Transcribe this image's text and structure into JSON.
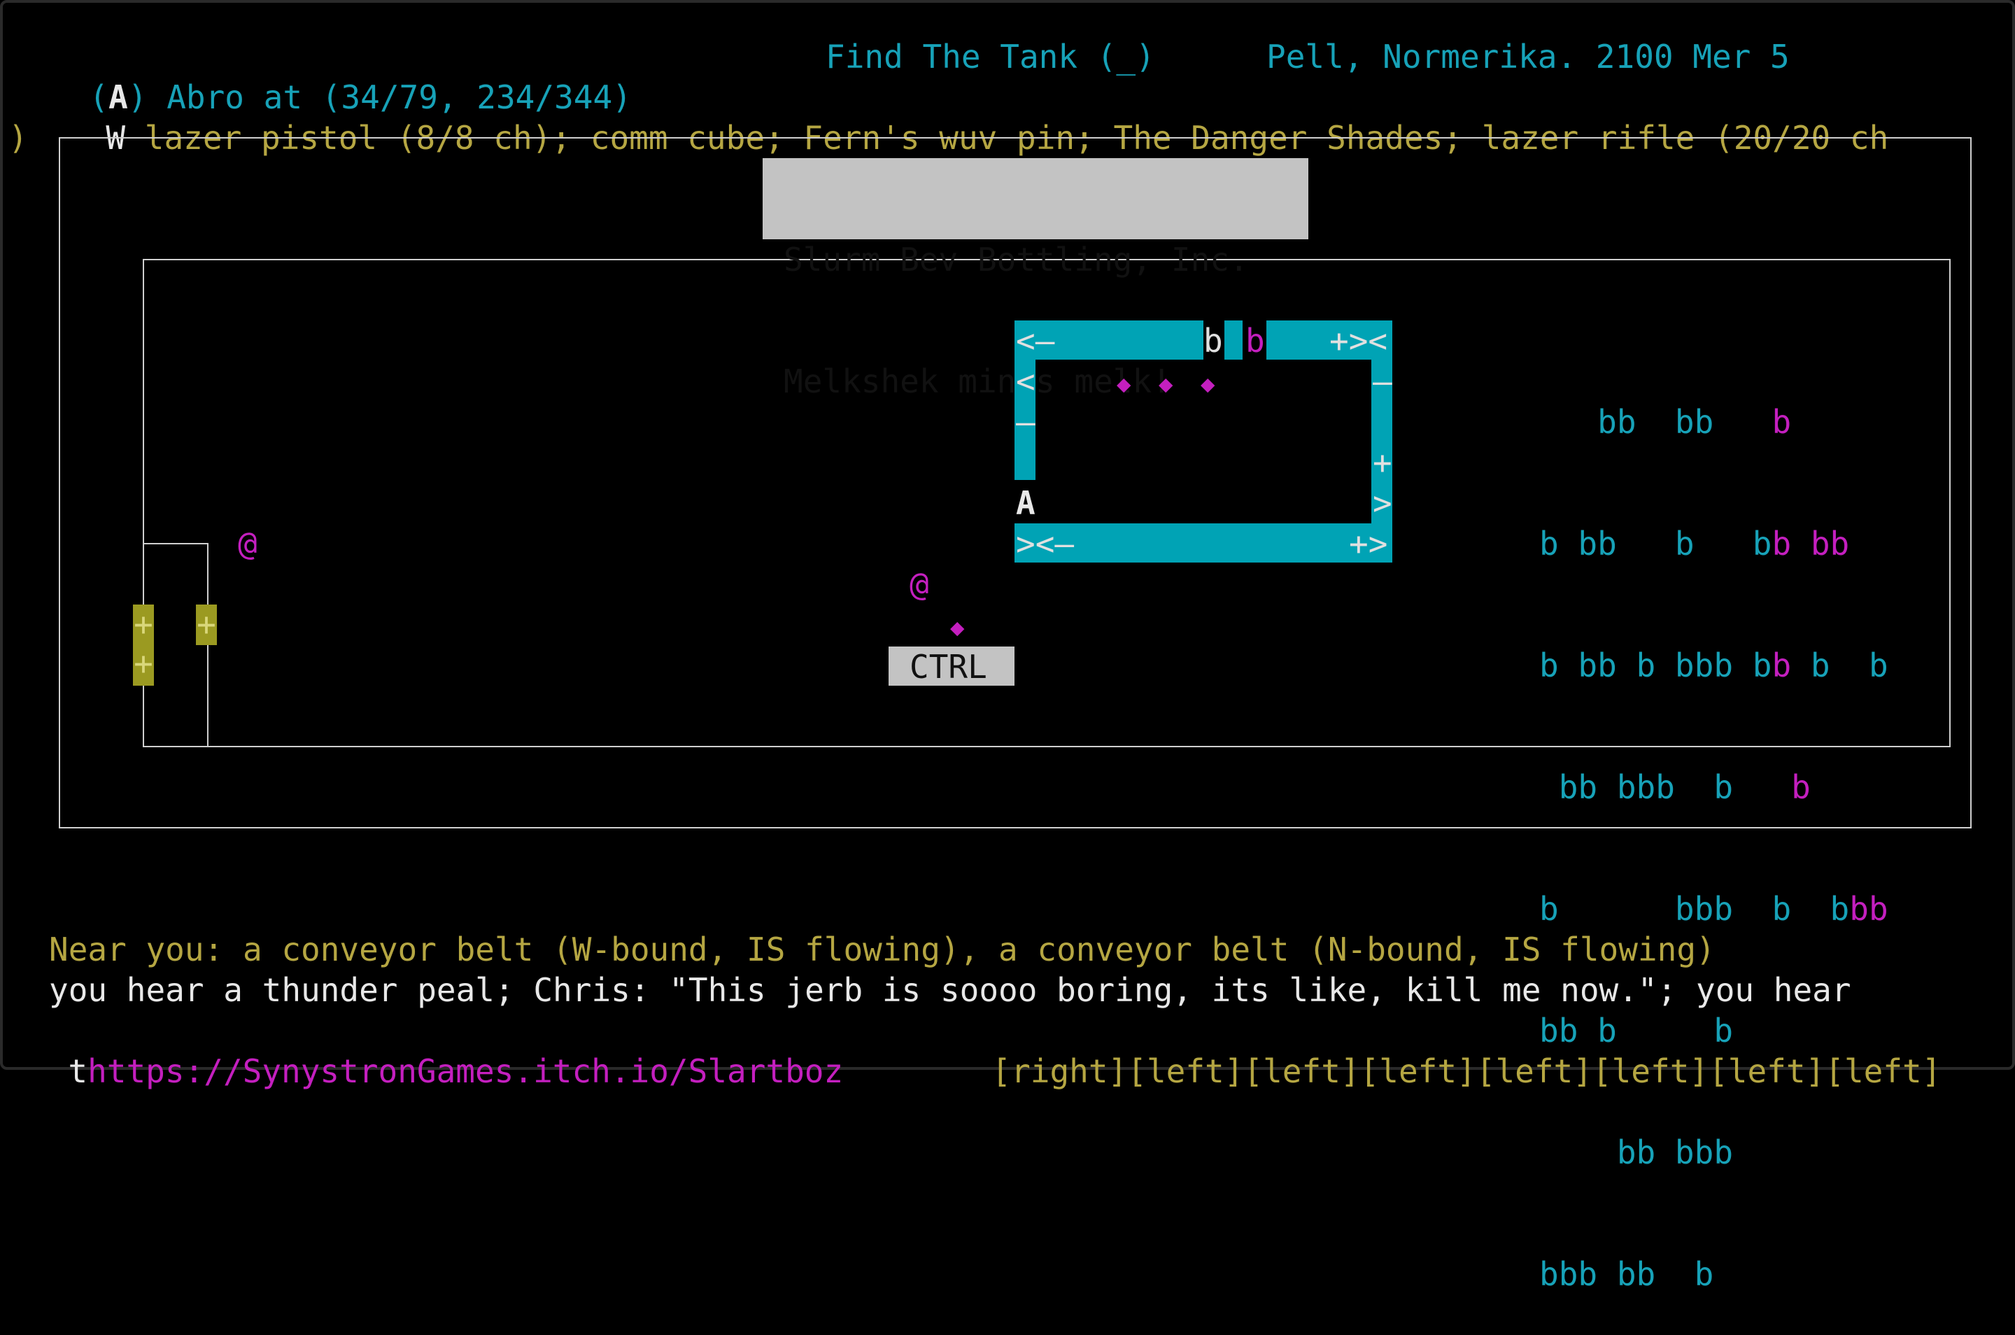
{
  "header": {
    "player_tag": "A",
    "player_location": "Abro at (34/79, 234/344)",
    "quest": "Find The Tank (_)",
    "place_date": "Pell, Normerika. 2100 Mer 5"
  },
  "inventory": {
    "weapon_key": "W",
    "items_line": "lazer pistol (8/8 ch); comm cube; Fern's wuv pin; The Danger Shades; lazer rifle (20/20 ch",
    "overflow": ")"
  },
  "sign": {
    "line1": "Slurm Bev Bottling, Inc.",
    "line2": "Melkshek minus melk!"
  },
  "map": {
    "player_marker": "A",
    "npc_glyph": "@",
    "item_glyph": "◆",
    "belt_top_left": "<–",
    "belt_top_right": "+><",
    "belt_left_mid1": "<",
    "belt_left_mid2": "–",
    "belt_right_mid1": "–",
    "belt_right_mid2": "+",
    "belt_right_mid3": ">",
    "belt_bottom_left": "><–",
    "belt_bottom_right": "+>",
    "belt_b1": "b",
    "belt_b2": "b",
    "ctrl_label": "CTRL",
    "door_glyph": "+",
    "bottles_rows": [
      "   bb  bb   b",
      "b bb   b   bb bb",
      "b bb b bbb bb b  b",
      " bb bbb  b   b",
      "b      bbb  b  bbb",
      "bb b     b",
      "    bb bbb",
      "bbb bb  b"
    ]
  },
  "messages": {
    "near": "Near you: a conveyor belt (W-bound, IS flowing), a conveyor belt (N-bound, IS flowing)",
    "log": "you hear a thunder peal; Chris: \"This jerb is soooo boring, its like, kill me now.\"; you hear",
    "log_start": "t",
    "link": "https://SynystronGames.itch.io/Slartboz",
    "keys": "[right][left][left][left][left][left][left][left]"
  },
  "colors": {
    "cyan": "#17a2b8",
    "olive": "#b5a642",
    "magenta": "#c41fbf",
    "belt": "#00a3b5",
    "sign_bg": "#c3c3c3"
  }
}
